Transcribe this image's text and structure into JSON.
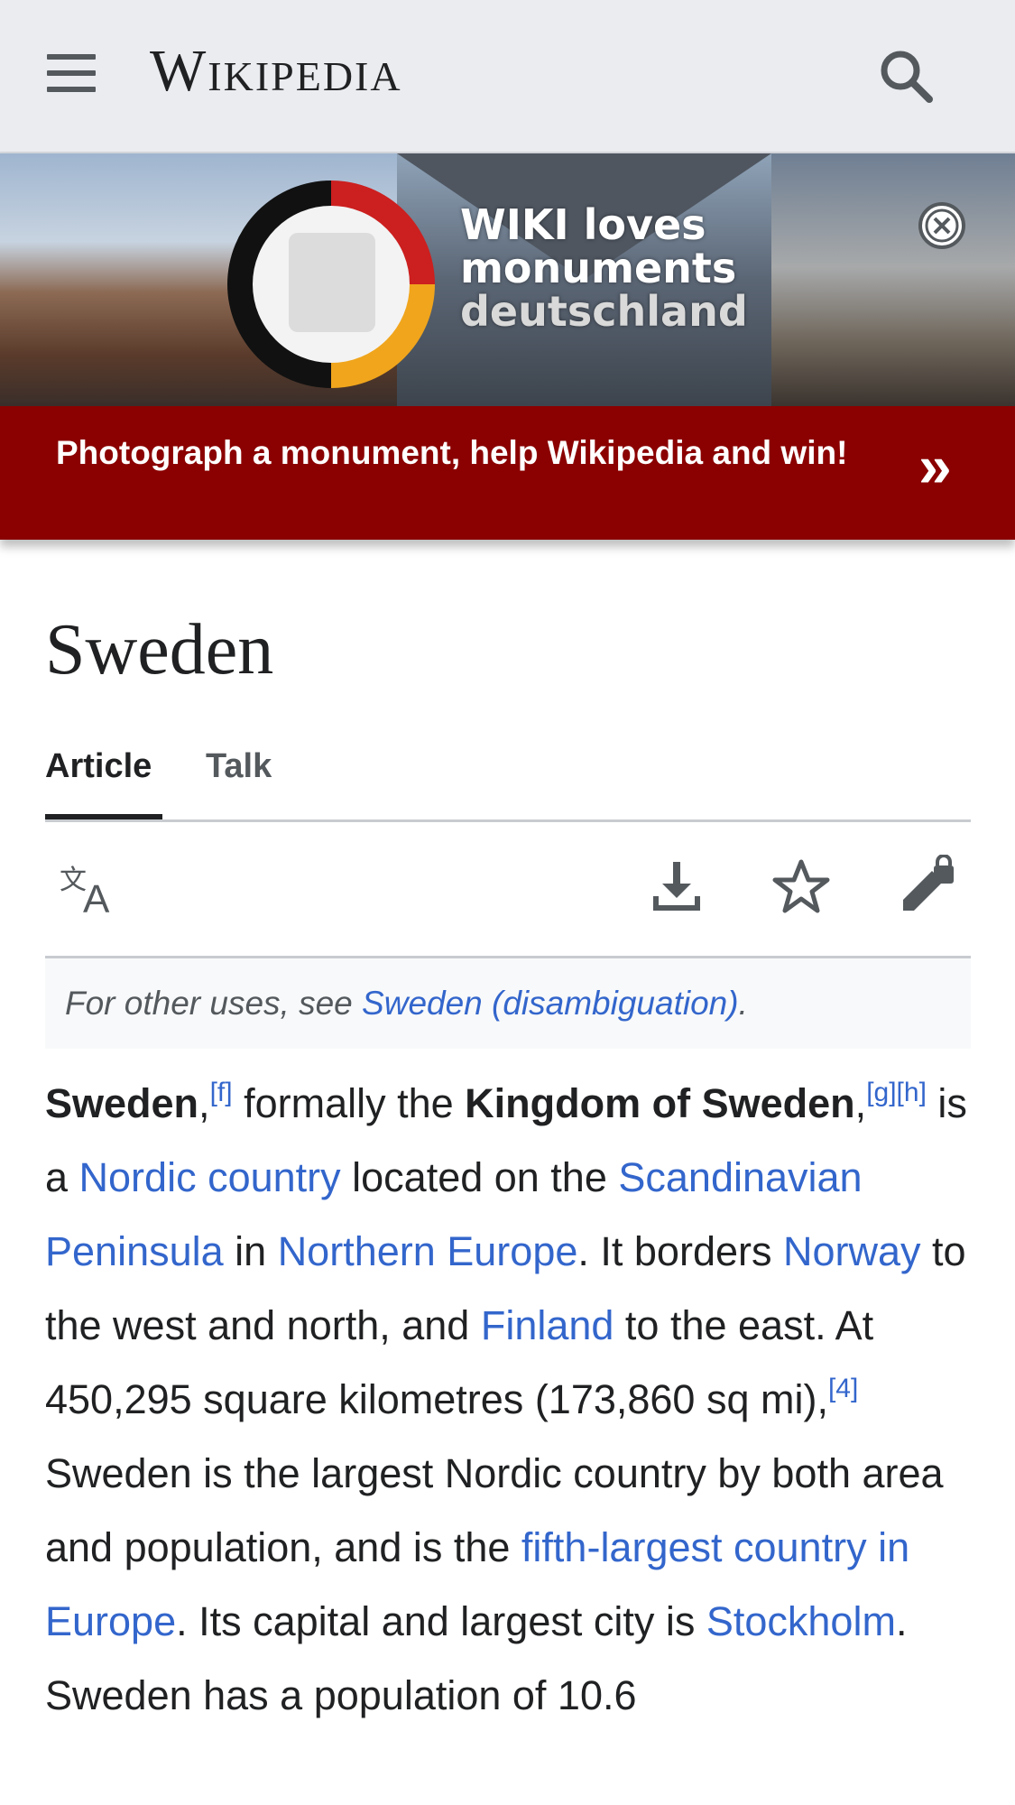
{
  "header": {
    "wordmark": "Wikipedia",
    "menu_icon": "hamburger-icon",
    "search_icon": "search-icon"
  },
  "banner": {
    "line1": "WIKI loves",
    "line2": "monuments",
    "line3": "deutschland",
    "cta": "Photograph a monument, help Wikipedia and win!",
    "arrow": "»",
    "close_icon": "close-circle-icon",
    "colors": {
      "bar": "#8b0000"
    }
  },
  "page": {
    "title": "Sweden",
    "tabs": [
      {
        "label": "Article",
        "active": true
      },
      {
        "label": "Talk",
        "active": false
      }
    ],
    "toolbar_icons": [
      "language-icon",
      "download-icon",
      "star-icon",
      "edit-lock-icon"
    ]
  },
  "hatnote": {
    "prefix": "For other uses, see ",
    "link": "Sweden (disambiguation)",
    "suffix": "."
  },
  "lead": {
    "s1_bold": "Sweden",
    "s1_comma": ",",
    "ref_f": "[f]",
    "s2": " formally the ",
    "s2_bold": "Kingdom of Sweden",
    "s2_comma": ",",
    "ref_g": "[g]",
    "ref_h": "[h]",
    "s3": " is a ",
    "link_nordic": "Nordic country",
    "s4": " located on the ",
    "link_peninsula": "Scandinavian Peninsula",
    "s5": " in ",
    "link_neurope": "Northern Europe",
    "s6": ". It borders ",
    "link_norway": "Norway",
    "s7": " to the west and north, and ",
    "link_finland": "Finland",
    "s8": " to the east. At 450,295 square kilometres (173,860 sq mi),",
    "ref_4": "[4]",
    "s9": " Sweden is the largest Nordic country by both area and population, and is the ",
    "link_fifth": "fifth-largest country in Europe",
    "s10": ". Its capital and largest city is ",
    "link_stockholm": "Stockholm",
    "s11": ". Sweden has a population of 10.6"
  },
  "colors": {
    "link": "#3366cc",
    "header_bg": "#eaecf0",
    "text": "#202122"
  }
}
